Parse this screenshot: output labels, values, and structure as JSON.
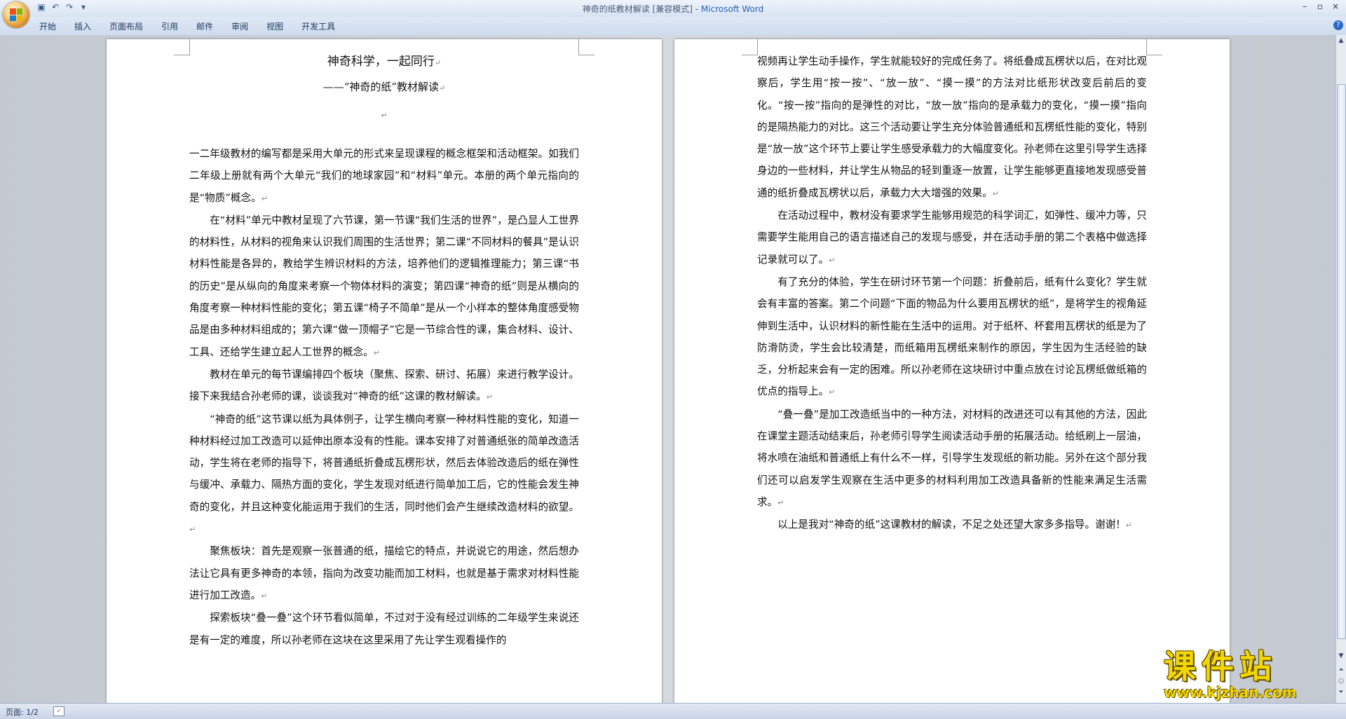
{
  "window": {
    "title_doc": "神奇的纸教材解读 [兼容模式] - ",
    "title_app": "Microsoft Word",
    "controls": [
      "–",
      "▫",
      "×"
    ]
  },
  "qat": {
    "save_icon": "save-icon",
    "undo_icon": "undo-icon",
    "redo_icon": "redo-icon"
  },
  "ribbon": {
    "tabs": [
      "开始",
      "插入",
      "页面布局",
      "引用",
      "邮件",
      "审阅",
      "视图",
      "开发工具"
    ],
    "help": "?"
  },
  "left_page": {
    "title": "神奇科学，一起同行",
    "subtitle": "——“神奇的纸”教材解读",
    "paragraphs": [
      "一二年级教材的编写都是采用大单元的形式来呈现课程的概念框架和活动框架。如我们二年级上册就有两个大单元“我们的地球家园”和“材料”单元。本册的两个单元指向的是“物质”概念。",
      "在“材料”单元中教材呈现了六节课，第一节课“我们生活的世界”，是凸显人工世界的材料性，从材料的视角来认识我们周围的生活世界；第二课“不同材料的餐具”是认识材料性能是各异的，教给学生辨识材料的方法，培养他们的逻辑推理能力；第三课“书的历史”是从纵向的角度来考察一个物体材料的演变；第四课“神奇的纸”则是从横向的角度考察一种材料性能的变化；第五课“椅子不简单”是从一个小样本的整体角度感受物品是由多种材料组成的；第六课“做一顶帽子”它是一节综合性的课，集合材料、设计、工具、还给学生建立起人工世界的概念。",
      "教材在单元的每节课编排四个板块（聚焦、探索、研讨、拓展）来进行教学设计。接下来我结合孙老师的课，谈谈我对“神奇的纸”这课的教材解读。",
      "“神奇的纸”这节课以纸为具体例子，让学生横向考察一种材料性能的变化，知道一种材料经过加工改造可以延伸出原本没有的性能。课本安排了对普通纸张的简单改造活动，学生将在老师的指导下，将普通纸折叠成瓦楞形状，然后去体验改造后的纸在弹性与缓冲、承载力、隔热方面的变化，学生发现对纸进行简单加工后，它的性能会发生神奇的变化，并且这种变化能运用于我们的生活，同时他们会产生继续改造材料的欲望。",
      "聚焦板块：首先是观察一张普通的纸，描绘它的特点，并说说它的用途，然后想办法让它具有更多神奇的本领，指向为改变功能而加工材料，也就是基于需求对材料性能进行加工改造。",
      "探索板块“叠一叠”这个环节看似简单，不过对于没有经过训练的二年级学生来说还是有一定的难度，所以孙老师在这块在这里采用了先让学生观看操作的"
    ]
  },
  "right_page": {
    "paragraphs": [
      "视频再让学生动手操作，学生就能较好的完成任务了。将纸叠成瓦楞状以后，在对比观察后，学生用“按一按”、“放一放”、“摸一摸”的方法对比纸形状改变后前后的变化。“按一按”指向的是弹性的对比，“放一放”指向的是承载力的变化，“摸一摸”指向的是隔热能力的对比。这三个活动要让学生充分体验普通纸和瓦楞纸性能的变化，特别是“放一放”这个环节上要让学生感受承载力的大幅度变化。孙老师在这里引导学生选择身边的一些材料，并让学生从物品的轻到重逐一放置，让学生能够更直接地发现感受普通的纸折叠成瓦楞状以后，承载力大大增强的效果。",
      "在活动过程中，教材没有要求学生能够用规范的科学词汇，如弹性、缓冲力等，只需要学生能用自己的语言描述自己的发现与感受，并在活动手册的第二个表格中做选择记录就可以了。",
      "有了充分的体验，学生在研讨环节第一个问题：折叠前后，纸有什么变化？学生就会有丰富的答案。第二个问题“下面的物品为什么要用瓦楞状的纸”，是将学生的视角延伸到生活中，认识材料的新性能在生活中的运用。对于纸杯、杯套用瓦楞状的纸是为了防滑防烫，学生会比较清楚，而纸箱用瓦楞纸来制作的原因，学生因为生活经验的缺乏，分析起来会有一定的困难。所以孙老师在这块研讨中重点放在讨论瓦楞纸做纸箱的优点的指导上。",
      "“叠一叠”是加工改造纸当中的一种方法，对材料的改进还可以有其他的方法，因此在课堂主题活动结束后，孙老师引导学生阅读活动手册的拓展活动。给纸刷上一层油，将水喷在油纸和普通纸上有什么不一样，引导学生发现纸的新功能。另外在这个部分我们还可以启发学生观察在生活中更多的材料利用加工改造具备新的性能来满足生活需求。",
      "以上是我对“神奇的纸”这课教材的解读，不足之处还望大家多多指导。谢谢！"
    ]
  },
  "paragraph_mark": "↵",
  "status": {
    "page": "页面: 1/2"
  },
  "watermark": {
    "main": "课件站",
    "url": "www.kjzhan.com"
  }
}
